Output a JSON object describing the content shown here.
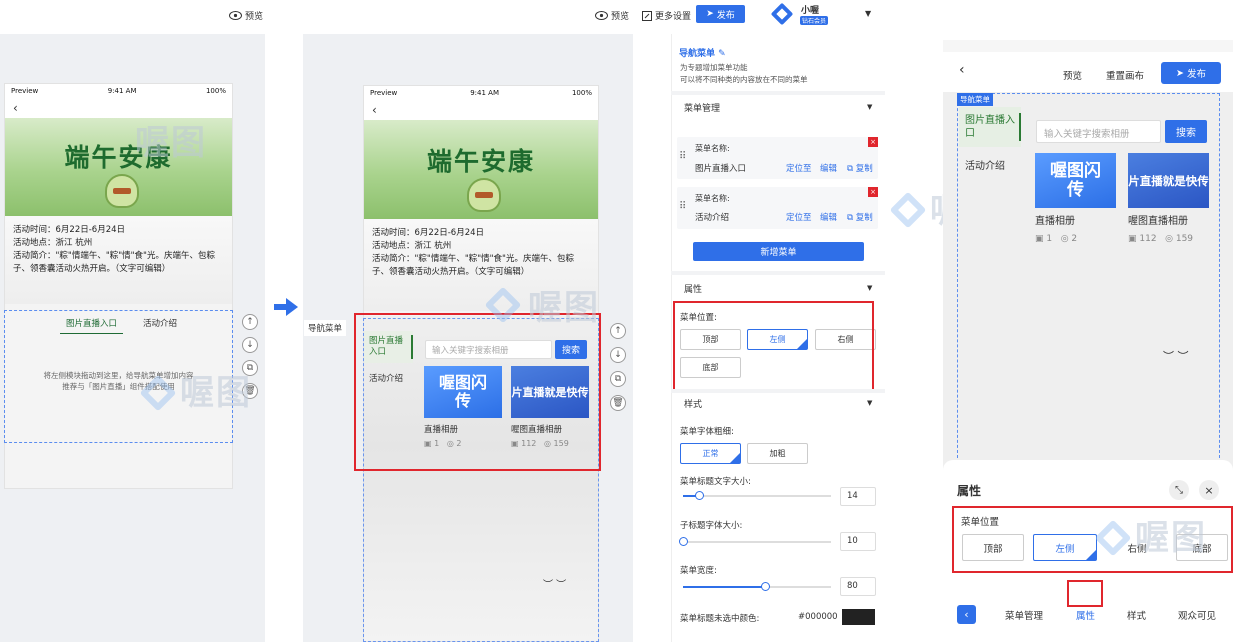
{
  "toolbar": {
    "preview_label": "预览",
    "more_settings_label": "更多设置",
    "publish_label": "发布",
    "user_name": "小喔",
    "user_badge": "钻石会员"
  },
  "phone": {
    "status_left": "Preview",
    "status_time": "9:41 AM",
    "status_right": "100%",
    "banner_title": "端午安康",
    "info_line1": "活动时间：6月22日-6月24日",
    "info_line2": "活动地点：浙江 杭州",
    "info_line3": "活动简介：\"粽\"情端午、\"粽\"情\"食\"光。庆端午、包粽子、领香囊活动火热开启。（文字可编辑）",
    "tab1": "图片直播入口",
    "tab2": "活动介绍",
    "empty_hint1": "将左侧模块拖动到这里，给导航菜单增加内容",
    "empty_hint2": "推荐与「图片直播」组件搭配使用"
  },
  "middle": {
    "nav_label": "导航菜单",
    "menu1": "图片直播入口",
    "menu2": "活动介绍",
    "search_placeholder": "输入关键字搜索相册",
    "search_btn": "搜索",
    "card1_img": "喔图闪传",
    "card1_title": "直播相册",
    "card1_photos": "1",
    "card1_views": "2",
    "card2_img": "片直播就是快传",
    "card2_title": "喔图直播相册",
    "card2_photos": "112",
    "card2_views": "159"
  },
  "panel": {
    "title": "导航菜单",
    "desc1": "为专题增加菜单功能",
    "desc2": "可以将不同种类的内容放在不同的菜单",
    "menu_mgmt": "菜单管理",
    "item_label": "菜单名称:",
    "item1_name": "图片直播入口",
    "item2_name": "活动介绍",
    "locate": "定位至",
    "edit": "编辑",
    "copy": "复制",
    "add_menu": "新增菜单",
    "attr": "属性",
    "menu_pos": "菜单位置:",
    "pos_top": "顶部",
    "pos_left": "左侧",
    "pos_right": "右侧",
    "pos_bottom": "底部",
    "style": "样式",
    "font_weight": "菜单字体粗细:",
    "fw_normal": "正常",
    "fw_bold": "加粗",
    "title_size_label": "菜单标题文字大小:",
    "title_size": "14",
    "sub_size_label": "子标题字体大小:",
    "sub_size": "10",
    "width_label": "菜单宽度:",
    "width": "80",
    "color_label": "菜单标题未选中颜色:",
    "color_value": "#000000"
  },
  "mobile": {
    "preview": "预览",
    "reset": "重置画布",
    "publish": "发布",
    "nav_tag": "导航菜单",
    "menu1": "图片直播入口",
    "menu2": "活动介绍",
    "search_placeholder": "输入关键字搜索相册",
    "search_btn": "搜索",
    "card1_img": "喔图闪传",
    "card1_title": "直播相册",
    "card1_photos": "1",
    "card1_views": "2",
    "card2_img": "片直播就是快传",
    "card2_title": "喔图直播相册",
    "card2_photos": "112",
    "card2_views": "159",
    "sheet_title": "属性",
    "menu_pos": "菜单位置",
    "pos_top": "顶部",
    "pos_left": "左侧",
    "pos_right": "右侧",
    "pos_bottom": "底部",
    "tab_mgmt": "菜单管理",
    "tab_attr": "属性",
    "tab_style": "样式",
    "tab_visible": "观众可见"
  },
  "watermark": "喔图",
  "colors": {
    "accent": "#2f6fe8",
    "highlight": "#e0262d",
    "dark_swatch": "#222222"
  }
}
